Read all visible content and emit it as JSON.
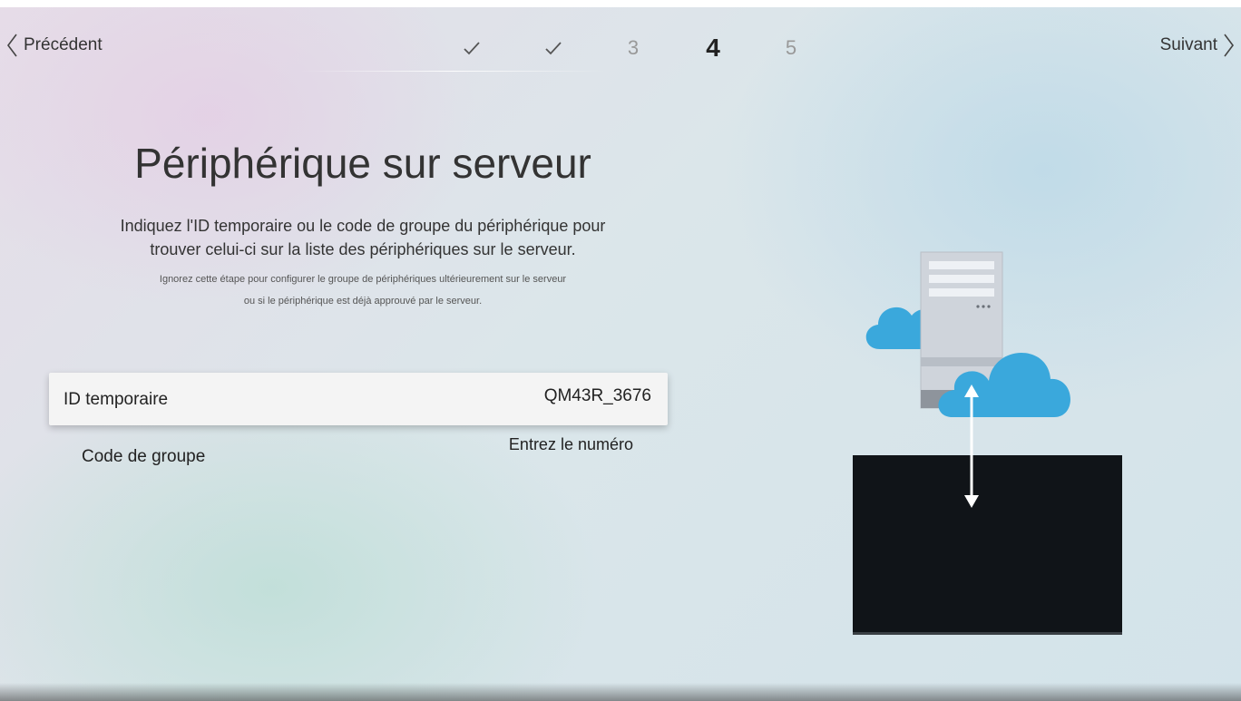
{
  "nav": {
    "prev_label": "Précédent",
    "next_label": "Suivant",
    "steps": [
      {
        "label": "✓",
        "state": "done"
      },
      {
        "label": "✓",
        "state": "done"
      },
      {
        "label": "3",
        "state": "pending"
      },
      {
        "label": "4",
        "state": "active"
      },
      {
        "label": "5",
        "state": "pending"
      }
    ]
  },
  "page": {
    "title": "Périphérique sur serveur",
    "description_line1": "Indiquez l'ID temporaire ou le code de groupe du périphérique pour",
    "description_line2": "trouver celui-ci sur la liste des périphériques sur le serveur.",
    "note_line1": "Ignorez cette étape pour configurer le groupe de périphériques ultérieurement sur le serveur",
    "note_line2": "ou si le périphérique est déjà approuvé par le serveur."
  },
  "fields": {
    "temp_id": {
      "label": "ID temporaire",
      "value": "QM43R_3676"
    },
    "group_code": {
      "label": "Code de groupe",
      "value": "Entrez le numéro"
    }
  },
  "icons": {
    "prev": "chevron-left-icon",
    "next": "chevron-right-icon",
    "done_step": "check-icon",
    "server": "server-icon",
    "cloud": "cloud-icon",
    "display": "display-icon",
    "arrow": "double-arrow-icon"
  },
  "colors": {
    "cloud": "#3aa8dc",
    "display": "#101418",
    "server": "#c9ced6"
  }
}
